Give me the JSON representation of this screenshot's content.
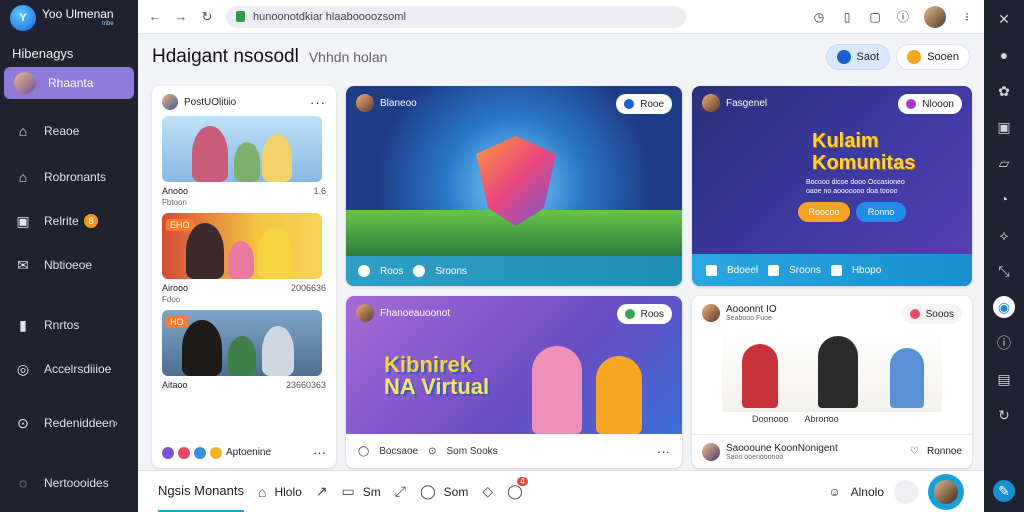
{
  "brand": {
    "name": "Yoo Ulmenan",
    "sub": "tribe"
  },
  "sidebar": {
    "heading": "Hibenagys",
    "items": [
      {
        "label": "Rhaanta",
        "icon": "avatar-icon"
      },
      {
        "label": "Reaoe",
        "icon": "home-icon"
      },
      {
        "label": "Robronants",
        "icon": "house-icon"
      },
      {
        "label": "Relrite",
        "icon": "book-icon",
        "badge": "8"
      },
      {
        "label": "Nbtioeoe",
        "icon": "mail-icon"
      },
      {
        "label": "Rnrtos",
        "icon": "chart-icon"
      },
      {
        "label": "Accelrsdiiioe",
        "icon": "compass-icon"
      },
      {
        "label": "Redeniddeen",
        "icon": "settings-icon"
      },
      {
        "label": "Nertoooides",
        "icon": "location-icon"
      }
    ]
  },
  "browser": {
    "url": "hunoonotdkiar hlaaboooozsoml"
  },
  "page": {
    "title": "Hdaigant nsosodl",
    "subtitle": "Vhhdn holan",
    "action1": "Saot",
    "action2": "Sooen"
  },
  "left_panel": {
    "author": "PostUOlitiio",
    "items": [
      {
        "title": "Anooo",
        "meta": "1.6",
        "sub": "Fbtoon",
        "tag": ""
      },
      {
        "title": "Airooo",
        "meta": "2006636",
        "sub": "Fdoo",
        "tag": "EHO"
      },
      {
        "title": "Aitaoo",
        "meta": "23660363",
        "sub": "",
        "tag": "HO"
      }
    ],
    "footer": "Aptoenine"
  },
  "card1": {
    "author": "Blaneoo",
    "chip": "Rooe",
    "foot1": "Roos",
    "foot2": "Sroons"
  },
  "card2": {
    "author": "Fasgenel",
    "chip": "Nlooon",
    "title1": "Kulaim",
    "title2": "Komunitas",
    "desc": "Bocooo dicoe dooo Occasioneo oaoe no aooooooo doa toooo",
    "btn1": "Roocoo",
    "btn2": "Ronno",
    "foot1": "Bdoeel",
    "foot2": "Sroons",
    "foot3": "Hbopo"
  },
  "card3": {
    "author": "Fhanoeauoonot",
    "chip": "Roos",
    "title1": "Kibnirek",
    "title2": "NA Virtual",
    "foot1": "Bocsaoe",
    "foot2": "Som Sooks"
  },
  "card4": {
    "author": "Aooonnt IO",
    "author_sub": "Seabooo Fuoe",
    "chip": "Sooos",
    "act1": "Doonooo",
    "act2": "Abronoo",
    "foot_name": "Saoooune KoonNonigent",
    "foot_sub": "Saoo ooenooonoo",
    "foot_action": "Ronnoe"
  },
  "bottom": {
    "items": [
      "Ngsis Monants",
      "Hlolo",
      "Sm",
      "Som"
    ],
    "badge": "4",
    "right": "Alnolo"
  }
}
